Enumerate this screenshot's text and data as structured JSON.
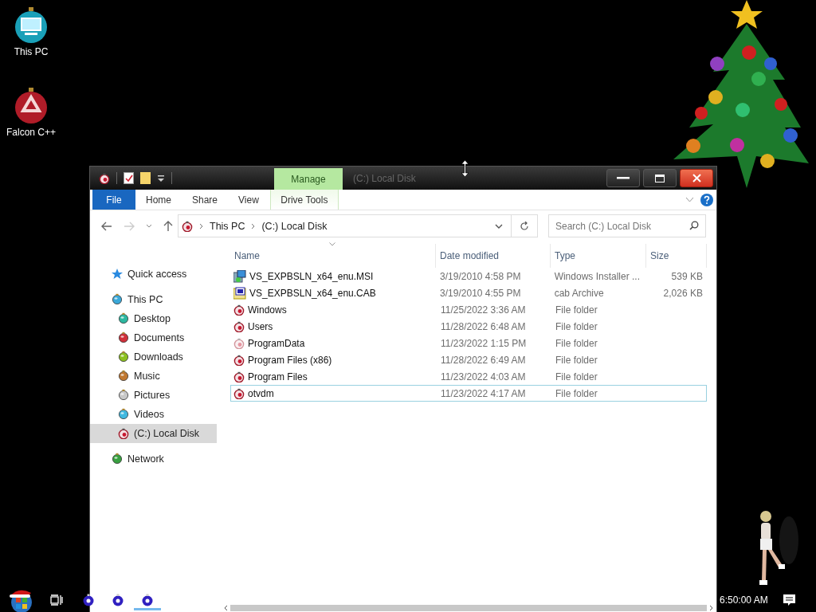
{
  "desktop_icons": [
    {
      "label": "This PC",
      "kind": "computer"
    },
    {
      "label": "Falcon C++",
      "kind": "recycle"
    }
  ],
  "window": {
    "title": "(C:) Local Disk",
    "context_tab": "Manage",
    "ribbon_tabs": [
      {
        "label": "File",
        "kind": "file",
        "selected": false
      },
      {
        "label": "Home",
        "kind": "normal",
        "selected": false
      },
      {
        "label": "Share",
        "kind": "normal",
        "selected": false
      },
      {
        "label": "View",
        "kind": "normal",
        "selected": false
      },
      {
        "label": "Drive Tools",
        "kind": "context",
        "selected": false
      }
    ],
    "breadcrumb": [
      "This PC",
      "(C:) Local Disk"
    ],
    "search": {
      "placeholder": "Search (C:) Local Disk"
    },
    "nav": [
      {
        "label": "Quick access",
        "kind": "star",
        "selected": false
      },
      {
        "label": "This PC",
        "kind": "ball",
        "color": "#3aa8d8",
        "selected": false,
        "children": [
          {
            "label": "Desktop",
            "kind": "ball",
            "color": "#2cb8a0",
            "selected": false
          },
          {
            "label": "Documents",
            "kind": "ball",
            "color": "#d0303a",
            "selected": false
          },
          {
            "label": "Downloads",
            "kind": "ball",
            "color": "#8cc020",
            "selected": false
          },
          {
            "label": "Music",
            "kind": "ball",
            "color": "#c07830",
            "selected": false
          },
          {
            "label": "Pictures",
            "kind": "ball",
            "color": "#c8c8c8",
            "selected": false
          },
          {
            "label": "Videos",
            "kind": "ball",
            "color": "#40b8e0",
            "selected": false
          },
          {
            "label": "(C:) Local Disk",
            "kind": "disk",
            "selected": true
          }
        ]
      },
      {
        "label": "Network",
        "kind": "ball",
        "color": "#38a040",
        "selected": false
      }
    ],
    "columns": [
      "Name",
      "Date modified",
      "Type",
      "Size"
    ],
    "rows": [
      {
        "name": "VS_EXPBSLN_x64_enu.MSI",
        "date": "3/19/2010 4:58 PM",
        "type": "Windows Installer ...",
        "size": "539 KB",
        "kind": "msi",
        "hidden": false,
        "focused": false
      },
      {
        "name": "VS_EXPBSLN_x64_enu.CAB",
        "date": "3/19/2010 4:55 PM",
        "type": "cab Archive",
        "size": "2,026 KB",
        "kind": "cab",
        "hidden": false,
        "focused": false
      },
      {
        "name": "Windows",
        "date": "11/25/2022 3:36 AM",
        "type": "File folder",
        "kind": "folder",
        "hidden": false,
        "focused": false
      },
      {
        "name": "Users",
        "date": "11/28/2022 6:48 AM",
        "type": "File folder",
        "kind": "folder",
        "hidden": false,
        "focused": false
      },
      {
        "name": "ProgramData",
        "date": "11/23/2022 1:15 PM",
        "type": "File folder",
        "kind": "folder",
        "hidden": true,
        "focused": false
      },
      {
        "name": "Program Files (x86)",
        "date": "11/28/2022 6:49 AM",
        "type": "File folder",
        "kind": "folder",
        "hidden": false,
        "focused": false
      },
      {
        "name": "Program Files",
        "date": "11/23/2022 4:03 AM",
        "type": "File folder",
        "kind": "folder",
        "hidden": false,
        "focused": false
      },
      {
        "name": "otvdm",
        "date": "11/23/2022 4:17 AM",
        "type": "File folder",
        "kind": "folder",
        "hidden": false,
        "focused": true
      }
    ]
  },
  "taskbar": {
    "apps": [
      {
        "active": false
      },
      {
        "active": false
      },
      {
        "active": true
      }
    ],
    "clock": "6:50:00 AM"
  }
}
